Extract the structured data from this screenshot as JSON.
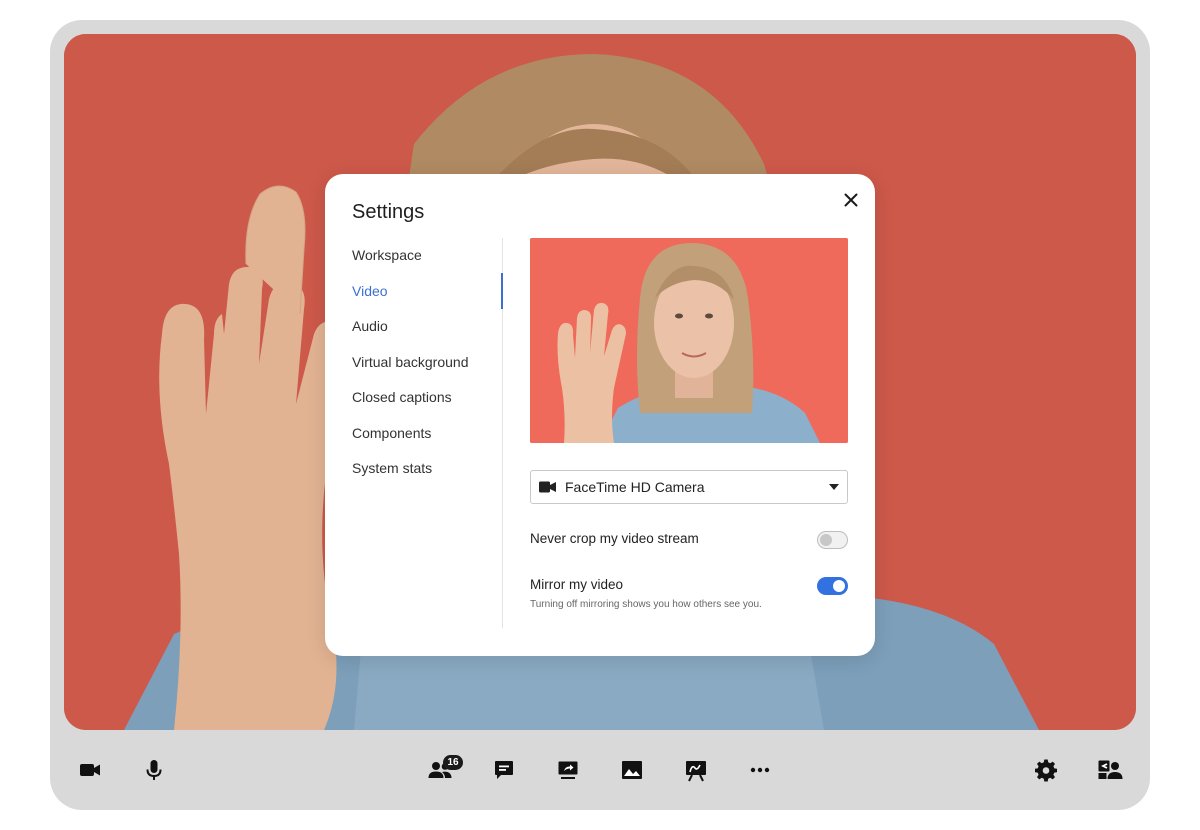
{
  "settings": {
    "title": "Settings",
    "nav": [
      {
        "label": "Workspace"
      },
      {
        "label": "Video",
        "active": true
      },
      {
        "label": "Audio"
      },
      {
        "label": "Virtual background"
      },
      {
        "label": "Closed captions"
      },
      {
        "label": "Components"
      },
      {
        "label": "System stats"
      }
    ],
    "video": {
      "camera_select_value": "FaceTime HD Camera",
      "never_crop_label": "Never crop my video stream",
      "never_crop_enabled": false,
      "mirror_label": "Mirror my video",
      "mirror_enabled": true,
      "mirror_hint": "Turning off mirroring shows you how others see you."
    }
  },
  "toolbar": {
    "participants_count": "16",
    "left": [
      "camera-icon",
      "microphone-icon"
    ],
    "center": [
      "participants-icon",
      "chat-icon",
      "screen-share-icon",
      "image-icon",
      "whiteboard-icon",
      "more-icon"
    ],
    "right": [
      "gear-icon",
      "user-switch-icon"
    ]
  },
  "colors": {
    "stage_background": "#cd594a",
    "preview_background": "#ef6a5a",
    "accent": "#3b6fd1",
    "toggle_on": "#3370e0",
    "frame": "#d9d9d9"
  }
}
